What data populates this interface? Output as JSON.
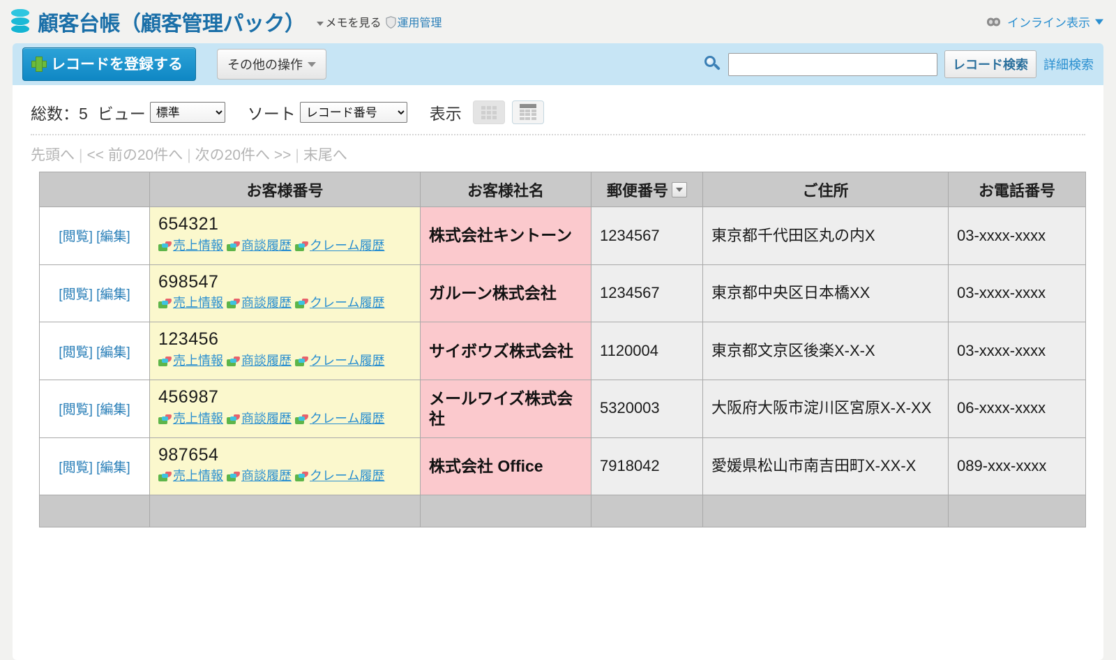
{
  "header": {
    "logo_icon": "database-icon",
    "title": "顧客台帳（顧客管理パック）",
    "memo_link": "メモを見る",
    "admin_link": "運用管理",
    "admin_icon": "shield-icon",
    "inline_display": "インライン表示",
    "inline_icon": "link-chain-icon"
  },
  "toolbar": {
    "add_record": "レコードを登録する",
    "other_actions": "その他の操作",
    "search_placeholder": "",
    "search_value": "",
    "search_button": "レコード検索",
    "advanced_search": "詳細検索",
    "search_icon": "magnifier-icon"
  },
  "controls": {
    "total_label": "総数：5",
    "view_label": "ビュー",
    "view_value": "標準",
    "sort_label": "ソート",
    "sort_value": "レコード番号",
    "display_label": "表示",
    "view_mode_card": "card-view-icon",
    "view_mode_table": "table-view-icon"
  },
  "pager": {
    "first": "先頭へ",
    "prev": "<< 前の20件へ",
    "next": "次の20件へ >>",
    "last": "末尾へ"
  },
  "table": {
    "columns": [
      "",
      "お客様番号",
      "お客様社名",
      "郵便番号",
      "ご住所",
      "お電話番号"
    ],
    "sorted_column": "郵便番号",
    "sub_link_labels": [
      "売上情報",
      "商談履歴",
      "クレーム履歴"
    ],
    "action_view": "[閲覧]",
    "action_edit": "[編集]",
    "rows": [
      {
        "number": "654321",
        "company": "株式会社キントーン",
        "zip": "1234567",
        "address": "東京都千代田区丸の内X",
        "tel": "03-xxxx-xxxx"
      },
      {
        "number": "698547",
        "company": "ガルーン株式会社",
        "zip": "1234567",
        "address": "東京都中央区日本橋XX",
        "tel": "03-xxxx-xxxx"
      },
      {
        "number": "123456",
        "company": "サイボウズ株式会社",
        "zip": "1120004",
        "address": "東京都文京区後楽X-X-X",
        "tel": "03-xxxx-xxxx"
      },
      {
        "number": "456987",
        "company": "メールワイズ株式会社",
        "zip": "5320003",
        "address": "大阪府大阪市淀川区宮原X-X-XX",
        "tel": "06-xxxx-xxxx"
      },
      {
        "number": "987654",
        "company": "株式会社 Office",
        "zip": "7918042",
        "address": "愛媛県松山市南吉田町X-XX-X",
        "tel": "089-xxx-xxxx"
      }
    ]
  },
  "colors": {
    "brand_blue": "#1a6fa8",
    "toolbar_band": "#c7e5f5",
    "primary_button": "#0f87c4",
    "number_cell": "#fbf8cd",
    "company_cell": "#fbc9cd",
    "data_cell": "#eeeeee",
    "header_cell": "#c9c9c9",
    "link_blue": "#2a8fd0"
  }
}
